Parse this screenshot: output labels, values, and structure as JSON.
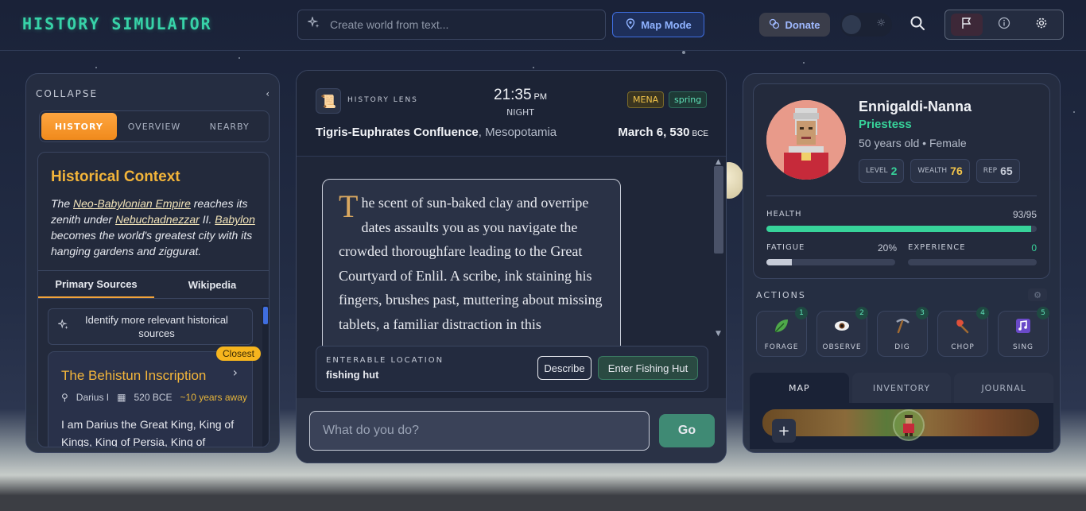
{
  "app": {
    "title": "HISTORY SIMULATOR"
  },
  "topbar": {
    "create_placeholder": "Create world from text...",
    "map_mode": "Map Mode",
    "donate": "Donate"
  },
  "left": {
    "collapse": "COLLAPSE",
    "tabs": [
      "HISTORY",
      "OVERVIEW",
      "NEARBY"
    ],
    "active_tab": "HISTORY",
    "context_title": "Historical Context",
    "context_parts": {
      "p1": "The ",
      "link1": "Neo-Babylonian Empire",
      "p2": " reaches its zenith under ",
      "link2": "Nebuchadnezzar",
      "p3": " II. ",
      "link3": "Babylon",
      "p4": " becomes the world's greatest city with its hanging gardens and ziggurat."
    },
    "source_tabs": [
      "Primary Sources",
      "Wikipedia"
    ],
    "identify_label": "Identify more relevant historical sources",
    "source": {
      "badge": "Closest",
      "title": "The Behistun Inscription",
      "author": "Darius I",
      "date": "520 BCE",
      "distance": "~10 years away",
      "excerpt": "I am Darius the Great King, King of Kings, King of Persia, King of"
    }
  },
  "center": {
    "lens_label": "HISTORY LENS",
    "time": "21:35",
    "ampm": "PM",
    "period": "NIGHT",
    "badges": {
      "region": "MENA",
      "season": "spring"
    },
    "place": "Tigris-Euphrates Confluence",
    "region_name": ", Mesopotamia",
    "date": "March 6, 530",
    "era": "BCE",
    "story_dropcap": "T",
    "story_text": "he scent of sun-baked clay and overripe dates assaults you as you navigate the crowded thoroughfare leading to the Great Courtyard of Enlil. A scribe, ink staining his fingers, brushes past, muttering about missing tablets, a familiar distraction in this",
    "enterable_label": "ENTERABLE LOCATION",
    "enterable_value": "fishing hut",
    "describe_btn": "Describe",
    "enter_btn": "Enter Fishing Hut",
    "command_placeholder": "What do you do?",
    "go_btn": "Go"
  },
  "right": {
    "name": "Ennigaldi-Nanna",
    "role": "Priestess",
    "info": "50 years old • Female",
    "chips": {
      "level_label": "LEVEL",
      "level": "2",
      "wealth_label": "WEALTH",
      "wealth": "76",
      "rep_label": "REP",
      "rep": "65"
    },
    "health_label": "HEALTH",
    "health": "93/95",
    "health_fraction": 0.979,
    "fatigue_label": "FATIGUE",
    "fatigue": "20%",
    "fatigue_fraction": 0.2,
    "experience_label": "EXPERIENCE",
    "experience": "0",
    "actions_label": "ACTIONS",
    "actions": [
      {
        "n": "1",
        "name": "FORAGE",
        "icon": "leaf-icon"
      },
      {
        "n": "2",
        "name": "OBSERVE",
        "icon": "eye-icon"
      },
      {
        "n": "3",
        "name": "DIG",
        "icon": "pickaxe-icon"
      },
      {
        "n": "4",
        "name": "CHOP",
        "icon": "axe-icon"
      },
      {
        "n": "5",
        "name": "SING",
        "icon": "music-icon"
      }
    ],
    "bottom_tabs": [
      "MAP",
      "INVENTORY",
      "JOURNAL"
    ],
    "map_zoom_in": "+"
  },
  "colors": {
    "accent_orange": "#f08a1c",
    "accent_green": "#37d39a",
    "accent_gold": "#f3b53a",
    "accent_blue": "#3f6ee0"
  }
}
